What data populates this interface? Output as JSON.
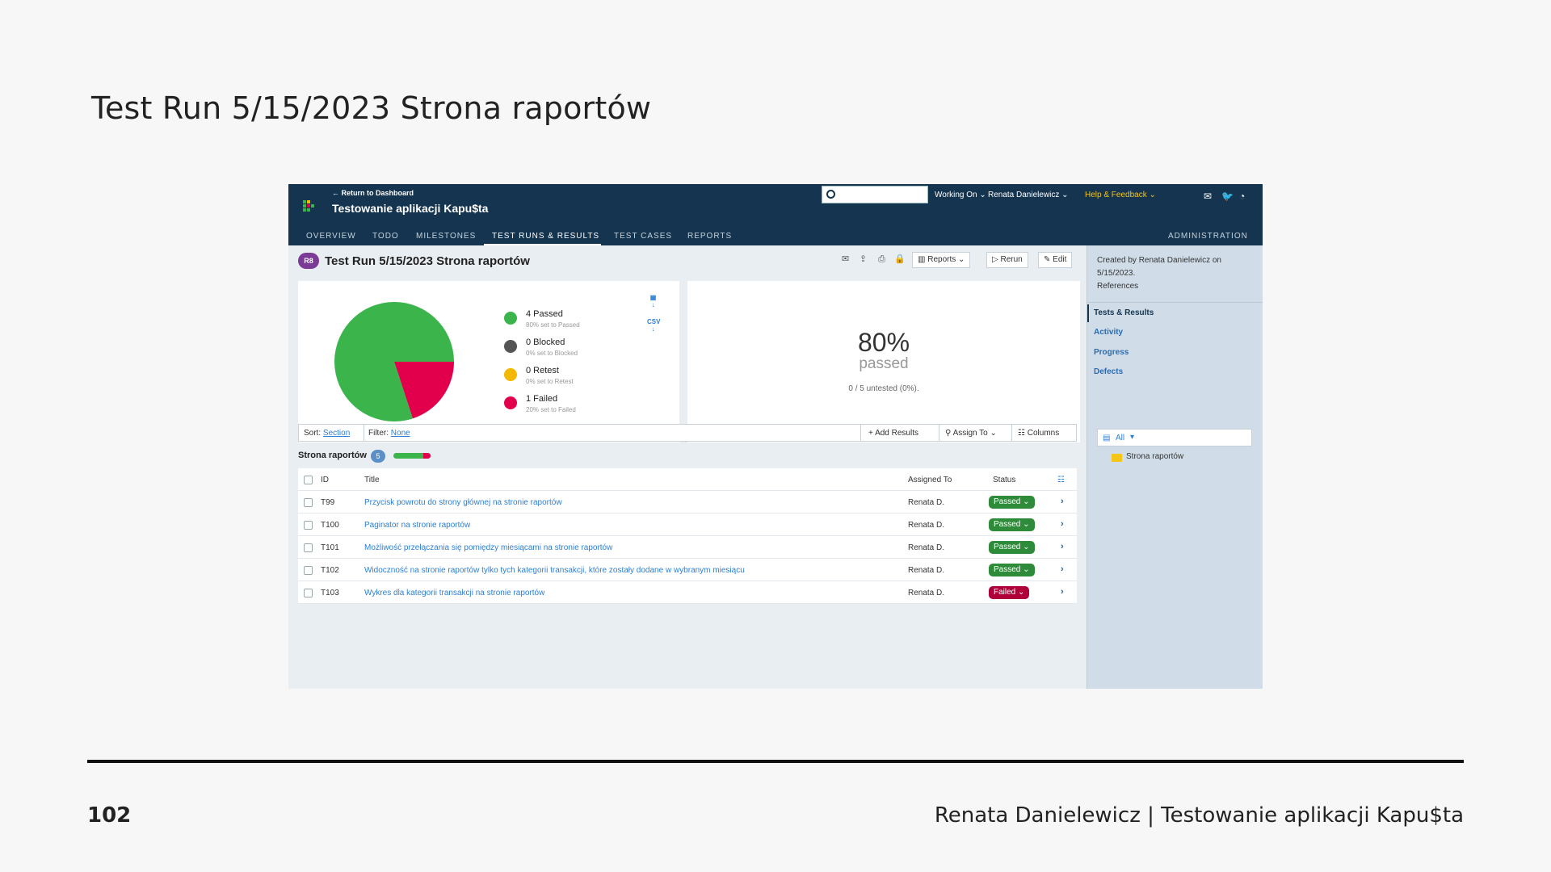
{
  "slide": {
    "title": "Test Run 5/15/2023 Strona raportów",
    "page_number": "102",
    "footer": "Renata Danielewicz | Testowanie aplikacji Kapu$ta"
  },
  "app": {
    "return_link": "← Return to Dashboard",
    "project_name": "Testowanie aplikacji Kapu$ta",
    "search": {
      "value": "",
      "placeholder": ""
    },
    "top_menu": {
      "working_on": "Working On",
      "user": "Renata Danielewicz",
      "help": "Help & Feedback"
    },
    "tabs": [
      "OVERVIEW",
      "TODO",
      "MILESTONES",
      "TEST RUNS & RESULTS",
      "TEST CASES",
      "REPORTS"
    ],
    "active_tab": "TEST RUNS & RESULTS",
    "admin": "ADMINISTRATION",
    "colors": {
      "header": "#14344f",
      "passed": "#3bb44c",
      "blocked": "#555555",
      "retest": "#f5b800",
      "failed": "#e2004c",
      "link": "#2b7fd4"
    }
  },
  "run": {
    "badge": "R8",
    "title": "Test Run 5/15/2023 Strona raportów",
    "toolbar": {
      "reports": "Reports",
      "rerun": "Rerun",
      "edit": "Edit"
    }
  },
  "chart_data": {
    "type": "pie",
    "categories": [
      "Passed",
      "Blocked",
      "Retest",
      "Failed"
    ],
    "values": [
      4,
      0,
      0,
      1
    ],
    "colors": [
      "#3bb44c",
      "#555555",
      "#f5b800",
      "#e2004c"
    ]
  },
  "legend": [
    {
      "label": "4 Passed",
      "sub": "80% set to Passed"
    },
    {
      "label": "0 Blocked",
      "sub": "0% set to Blocked"
    },
    {
      "label": "0 Retest",
      "sub": "0% set to Retest"
    },
    {
      "label": "1 Failed",
      "sub": "20% set to Failed"
    }
  ],
  "downloads": {
    "csv": "CSV"
  },
  "summary": {
    "percent": "80%",
    "label": "passed",
    "untested": "0 / 5 untested (0%)."
  },
  "filterbar": {
    "sort_label": "Sort:",
    "sort_value": "Section",
    "filter_label": "Filter:",
    "filter_value": "None",
    "add_results": "Add Results",
    "assign_to": "Assign To",
    "columns": "Columns"
  },
  "section": {
    "name": "Strona raportów",
    "count": "5",
    "passed_fraction": 0.8
  },
  "table": {
    "headers": {
      "id": "ID",
      "title": "Title",
      "assigned": "Assigned To",
      "status": "Status"
    },
    "rows": [
      {
        "id": "T99",
        "title": "Przycisk powrotu do strony głównej na stronie raportów",
        "assigned": "Renata D.",
        "status": "Passed"
      },
      {
        "id": "T100",
        "title": "Paginator na stronie raportów",
        "assigned": "Renata D.",
        "status": "Passed"
      },
      {
        "id": "T101",
        "title": "Możliwość przełączania się pomiędzy miesiącami na stronie raportów",
        "assigned": "Renata D.",
        "status": "Passed"
      },
      {
        "id": "T102",
        "title": "Widoczność na stronie raportów tylko tych kategorii transakcji, które zostały dodane w wybranym miesiącu",
        "assigned": "Renata D.",
        "status": "Passed"
      },
      {
        "id": "T103",
        "title": "Wykres dla kategorii transakcji na stronie raportów",
        "assigned": "Renata D.",
        "status": "Failed"
      }
    ]
  },
  "sidebar": {
    "created_line1": "Created by Renata Danielewicz on",
    "created_line2": "5/15/2023.",
    "references": "References",
    "links": [
      "Tests & Results",
      "Activity",
      "Progress",
      "Defects"
    ],
    "tree_filter": "All",
    "tree_item": "Strona raportów"
  }
}
